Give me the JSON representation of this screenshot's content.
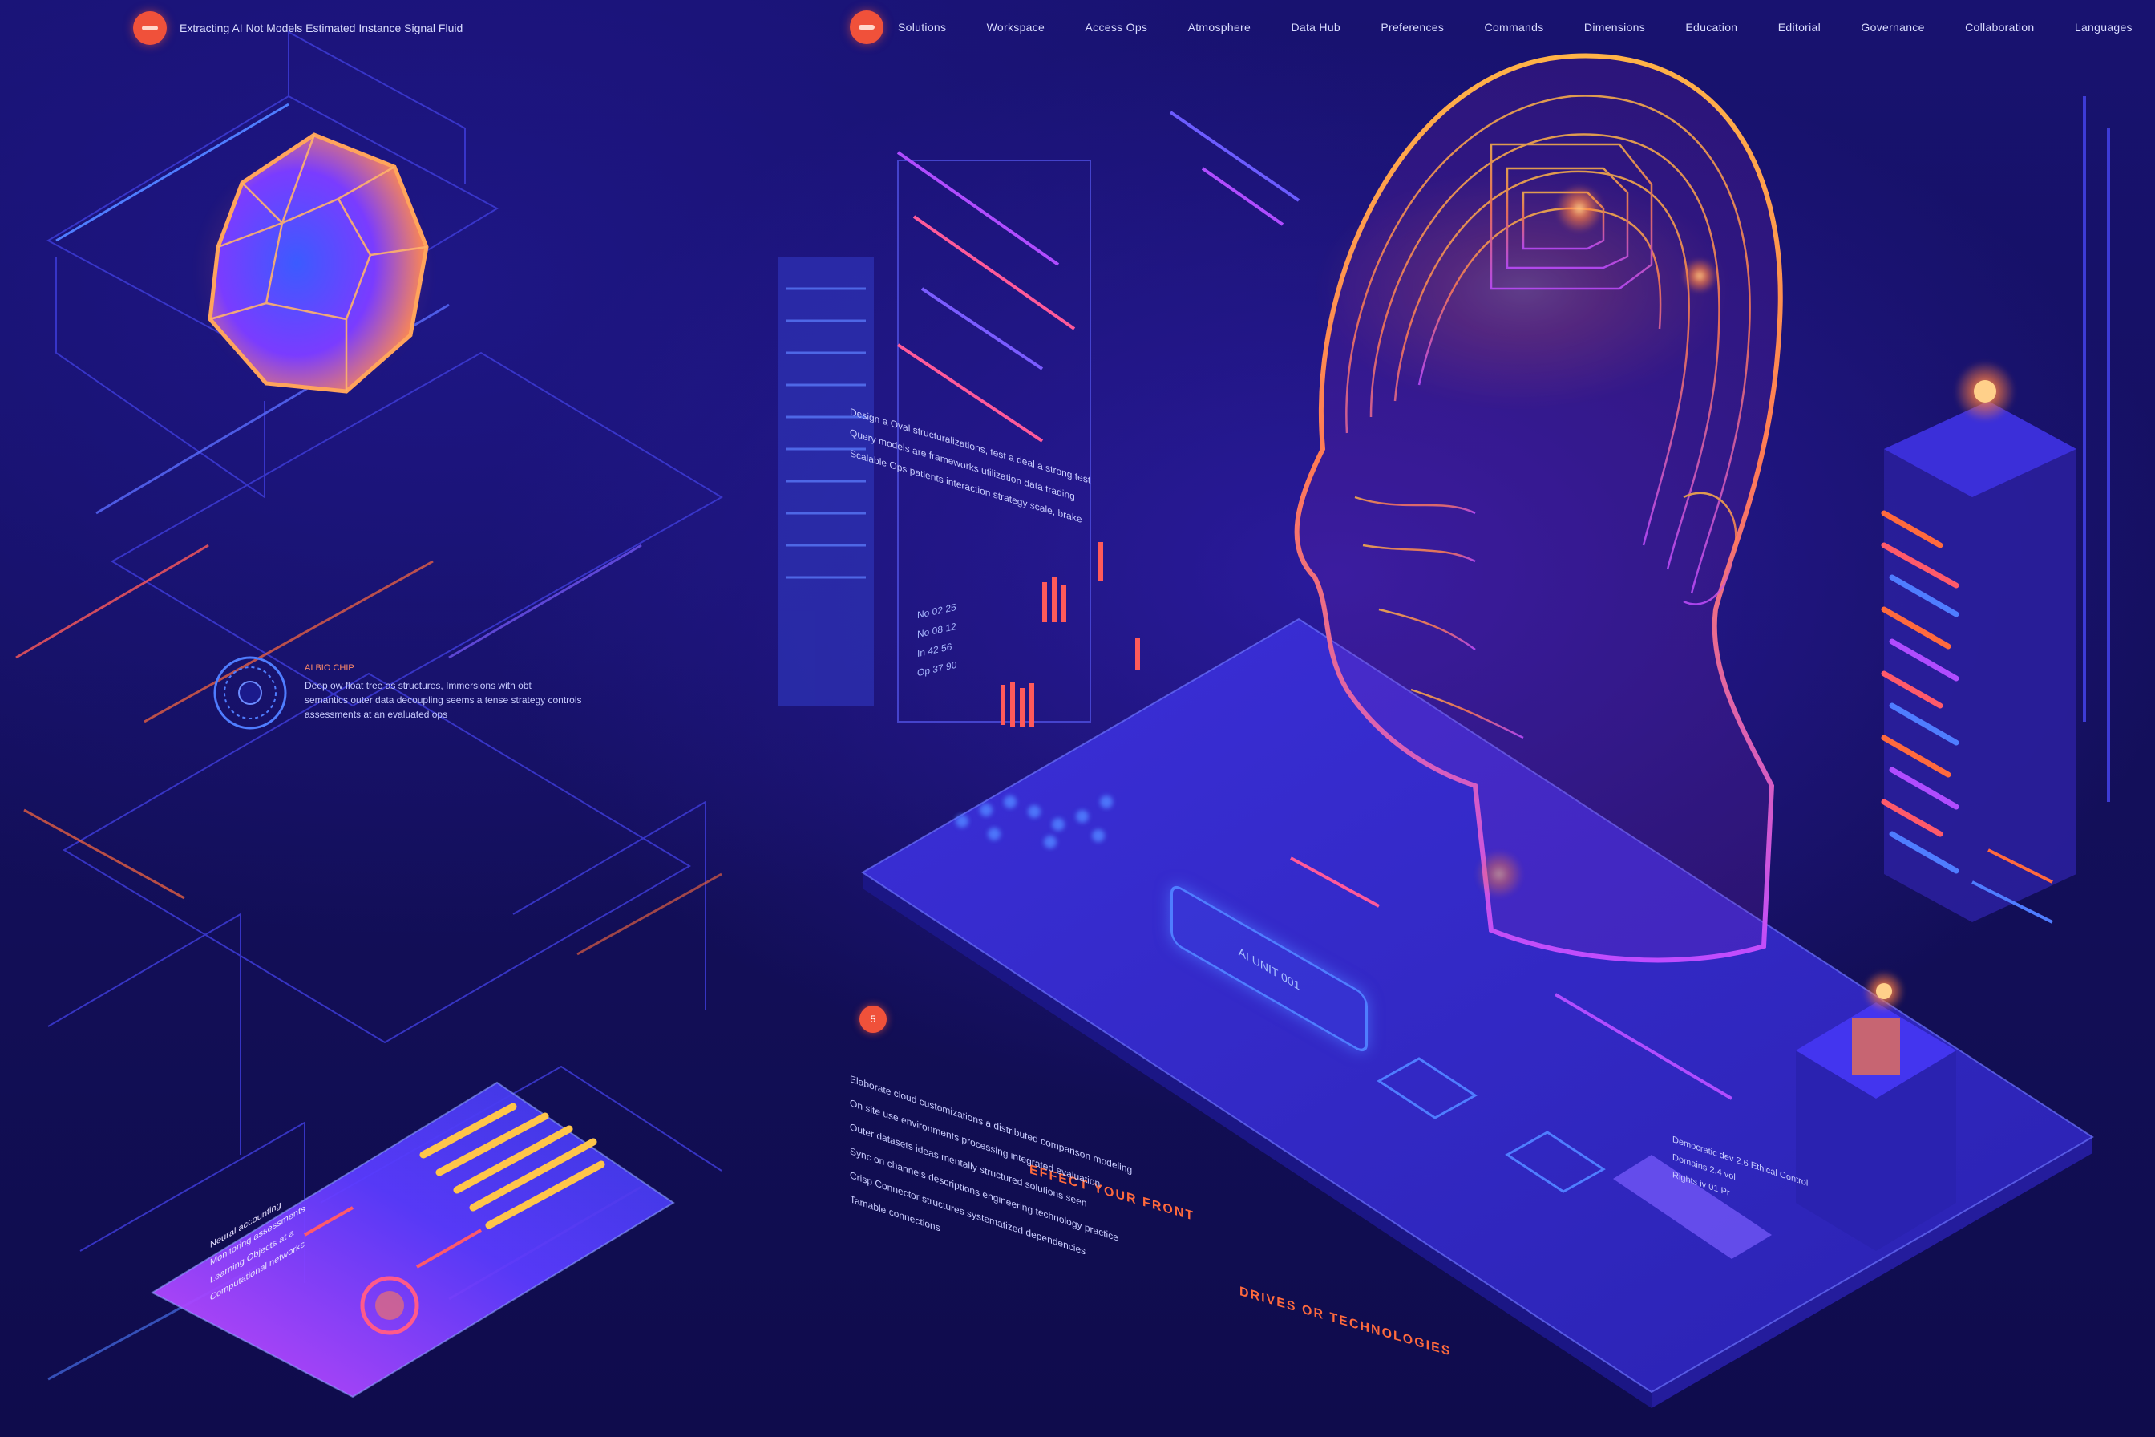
{
  "left_header": {
    "title": "Extracting AI Not Models Estimated Instance Signal Fluid"
  },
  "nav": {
    "items": [
      "Solutions",
      "Workspace",
      "Access Ops",
      "Atmosphere",
      "Data Hub",
      "Preferences",
      "Commands",
      "Dimensions",
      "Education",
      "Editorial",
      "Governance",
      "Collaboration",
      "Languages"
    ]
  },
  "left_info": {
    "heading": "AI BIO CHIP",
    "lines": [
      "Deep ow float tree as structures, Immersions with obt",
      "semantics outer data decoupling seems a tense strategy controls",
      "assessments at an evaluated ops"
    ]
  },
  "card": {
    "lines": [
      "Neural accounting",
      "Monitoring assessments",
      "Learning Objects at a",
      "Computational networks"
    ]
  },
  "mid_text": {
    "lines": [
      "Design a Oval structuralizations, test a deal a strong test",
      "Query models are frameworks utilization data trading",
      "Scalable Ops patients interaction strategy scale, brake"
    ]
  },
  "side_panel": {
    "lines": [
      "No 02 25",
      "No 08 12",
      "In 42 56",
      "Op 37 90"
    ]
  },
  "step": {
    "number": "5"
  },
  "bottom_title": "EFFECT YOUR FRONT",
  "bottom_text": {
    "lines": [
      "Elaborate cloud customizations a distributed comparison modeling",
      "On site use environments processing integrated evaluation",
      "Outer datasets ideas mentally structured solutions seen",
      "Sync on channels descriptions engineering technology practice",
      "Crisp Connector structures systematized dependencies",
      "Tamable connections"
    ]
  },
  "bottom_title_2": "DRIVES OR TECHNOLOGIES",
  "platform_button": {
    "label": "AI UNIT 001"
  },
  "right_note": {
    "lines": [
      "Democratic dev 2.6 Ethical Control",
      "Domains 2.4 vol",
      "Rights iv 01 Pr"
    ]
  },
  "colors": {
    "background": "#14105e",
    "accent_orange": "#ff6a3d",
    "accent_blue": "#4f7dff",
    "accent_purple": "#b04cff",
    "accent_gold": "#ffb347"
  }
}
